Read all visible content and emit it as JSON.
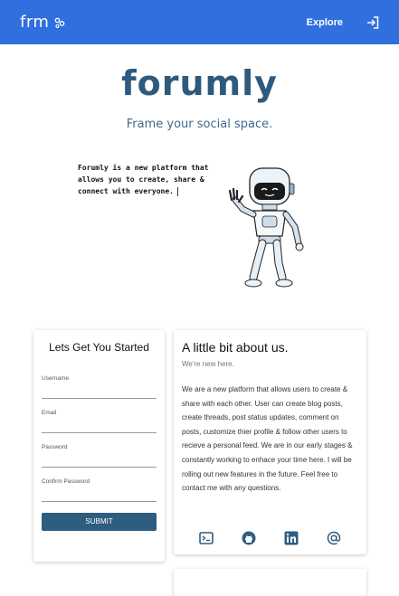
{
  "header": {
    "brand": "frm",
    "explore_label": "Explore"
  },
  "hero": {
    "title": "forumly",
    "tagline": "Frame your social space.",
    "typed_text": "Forumly is a new platform that allows you to create, share & connect with everyone."
  },
  "signup": {
    "title": "Lets Get You Started",
    "fields": [
      {
        "label": "Username",
        "value": ""
      },
      {
        "label": "Email",
        "value": ""
      },
      {
        "label": "Password",
        "value": ""
      },
      {
        "label": "Confirm Password",
        "value": ""
      }
    ],
    "submit_label": "SUBMIT"
  },
  "about": {
    "title": "A little bit about us.",
    "subtitle": "We're new here.",
    "body": "We are a new platform that allows users to create & share with each other. User can create blog posts, create threads, post status updates, comment on posts, customize thier profile & follow other users to recieve a personal feed. We are in our early stages & constantly working to enhace your time here. I will be rolling out new features in the future. Feel free to contact me with any questions.",
    "socials": [
      "terminal-icon",
      "github-icon",
      "linkedin-icon",
      "at-icon"
    ]
  },
  "colors": {
    "topbar": "#2f6fde",
    "brand_text": "#2e5a7e",
    "button": "#2f5d80"
  }
}
